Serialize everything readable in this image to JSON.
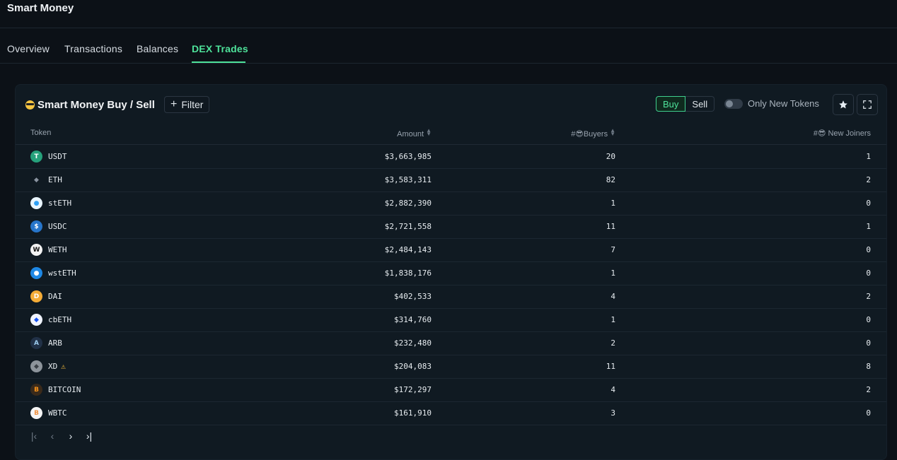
{
  "app": {
    "title": "Smart Money"
  },
  "tabs": [
    {
      "label": "Overview",
      "active": false
    },
    {
      "label": "Transactions",
      "active": false
    },
    {
      "label": "Balances",
      "active": false
    },
    {
      "label": "DEX Trades",
      "active": true
    }
  ],
  "panel": {
    "title": "Smart Money Buy / Sell",
    "filter_label": "Filter",
    "segment": {
      "buy": "Buy",
      "sell": "Sell",
      "selected": "Buy"
    },
    "toggle_label": "Only New Tokens",
    "toggle_on": false
  },
  "table": {
    "headers": {
      "token": "Token",
      "amount": "Amount",
      "buyers": "#😎Buyers",
      "joiners": "#😎 New Joiners"
    },
    "rows": [
      {
        "token": "USDT",
        "amount": "$3,663,985",
        "buyers": "20",
        "joiners": "1",
        "icon": "usdt-icon"
      },
      {
        "token": "ETH",
        "amount": "$3,583,311",
        "buyers": "82",
        "joiners": "2",
        "icon": "eth-icon"
      },
      {
        "token": "stETH",
        "amount": "$2,882,390",
        "buyers": "1",
        "joiners": "0",
        "icon": "steth-icon"
      },
      {
        "token": "USDC",
        "amount": "$2,721,558",
        "buyers": "11",
        "joiners": "1",
        "icon": "usdc-icon"
      },
      {
        "token": "WETH",
        "amount": "$2,484,143",
        "buyers": "7",
        "joiners": "0",
        "icon": "weth-icon"
      },
      {
        "token": "wstETH",
        "amount": "$1,838,176",
        "buyers": "1",
        "joiners": "0",
        "icon": "wsteth-icon"
      },
      {
        "token": "DAI",
        "amount": "$402,533",
        "buyers": "4",
        "joiners": "2",
        "icon": "dai-icon"
      },
      {
        "token": "cbETH",
        "amount": "$314,760",
        "buyers": "1",
        "joiners": "0",
        "icon": "cbeth-icon"
      },
      {
        "token": "ARB",
        "amount": "$232,480",
        "buyers": "2",
        "joiners": "0",
        "icon": "arb-icon"
      },
      {
        "token": "XD",
        "amount": "$204,083",
        "buyers": "11",
        "joiners": "8",
        "icon": "xd-icon",
        "warning": true
      },
      {
        "token": "BITCOIN",
        "amount": "$172,297",
        "buyers": "4",
        "joiners": "2",
        "icon": "bitcoin-icon"
      },
      {
        "token": "WBTC",
        "amount": "$161,910",
        "buyers": "3",
        "joiners": "0",
        "icon": "wbtc-icon"
      }
    ]
  },
  "colors": {
    "accent": "#4ee29a",
    "background": "#0c1117",
    "panel": "#101a22",
    "warning": "#f2b93b"
  }
}
